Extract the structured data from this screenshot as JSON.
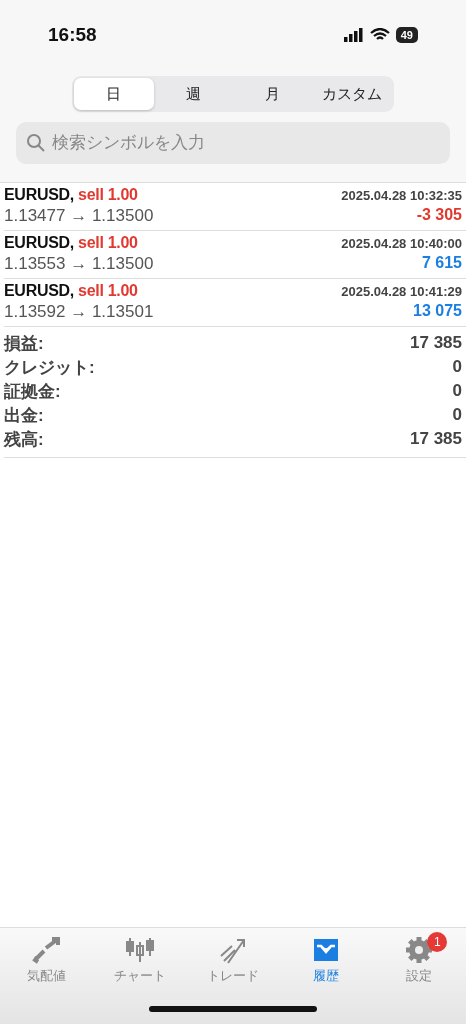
{
  "status_bar": {
    "time": "16:58",
    "battery": "49"
  },
  "period_tabs": [
    {
      "label": "日",
      "selected": true
    },
    {
      "label": "週",
      "selected": false
    },
    {
      "label": "月",
      "selected": false
    },
    {
      "label": "カスタム",
      "selected": false
    }
  ],
  "search": {
    "placeholder": "検索シンボルを入力"
  },
  "trades": [
    {
      "symbol": "EURUSD,",
      "order": "sell 1.00",
      "time": "2025.04.28 10:32:35",
      "prices": "1.13477 → 1.13500",
      "profit": "-3 305",
      "kind": "loss"
    },
    {
      "symbol": "EURUSD,",
      "order": "sell 1.00",
      "time": "2025.04.28 10:40:00",
      "prices": "1.13553 → 1.13500",
      "profit": "7 615",
      "kind": "gain"
    },
    {
      "symbol": "EURUSD,",
      "order": "sell 1.00",
      "time": "2025.04.28 10:41:29",
      "prices": "1.13592 → 1.13501",
      "profit": "13 075",
      "kind": "gain"
    }
  ],
  "summary": [
    {
      "label": "損益:",
      "value": "17 385"
    },
    {
      "label": "クレジット:",
      "value": "0"
    },
    {
      "label": "証拠金:",
      "value": "0"
    },
    {
      "label": "出金:",
      "value": "0"
    },
    {
      "label": "残高:",
      "value": "17 385"
    }
  ],
  "tab_bar": [
    {
      "label": "気配値",
      "kind": "quotes",
      "selected": false
    },
    {
      "label": "チャート",
      "kind": "chart",
      "selected": false
    },
    {
      "label": "トレード",
      "kind": "trade",
      "selected": false
    },
    {
      "label": "履歴",
      "kind": "history",
      "selected": true
    },
    {
      "label": "設定",
      "kind": "settings",
      "selected": false,
      "badge": "1"
    }
  ]
}
